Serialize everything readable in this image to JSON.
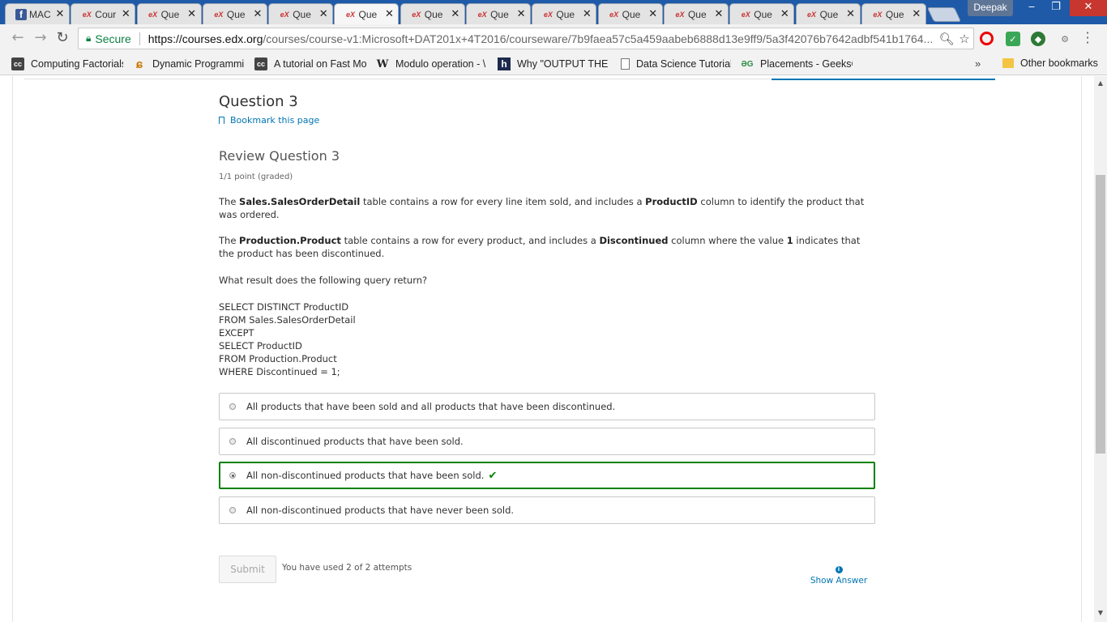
{
  "browser": {
    "tabs": [
      {
        "icon": "facebook-icon",
        "title": "MAC",
        "active": false
      },
      {
        "icon": "edx-icon",
        "title": "Cour",
        "active": false
      },
      {
        "icon": "edx-icon",
        "title": "Que",
        "active": false
      },
      {
        "icon": "edx-icon",
        "title": "Que",
        "active": false
      },
      {
        "icon": "edx-icon",
        "title": "Que",
        "active": false
      },
      {
        "icon": "edx-icon",
        "title": "Que",
        "active": true
      },
      {
        "icon": "edx-icon",
        "title": "Que",
        "active": false
      },
      {
        "icon": "edx-icon",
        "title": "Que",
        "active": false
      },
      {
        "icon": "edx-icon",
        "title": "Que",
        "active": false
      },
      {
        "icon": "edx-icon",
        "title": "Que",
        "active": false
      },
      {
        "icon": "edx-icon",
        "title": "Que",
        "active": false
      },
      {
        "icon": "edx-icon",
        "title": "Que",
        "active": false
      },
      {
        "icon": "edx-icon",
        "title": "Que",
        "active": false
      },
      {
        "icon": "edx-icon",
        "title": "Que",
        "active": false
      }
    ],
    "profile_name": "Deepak",
    "secure_label": "Secure",
    "url_scheme_host": "https://courses.edx.org",
    "url_path": "/courses/course-v1:Microsoft+DAT201x+4T2016/courseware/7b9faea57c5a459aabeb6888d13e9ff9/5a3f42076b7642adbf541b1764..."
  },
  "bookmarks": [
    {
      "icon": "cc-icon",
      "label": "Computing Factorials"
    },
    {
      "icon": "dp-icon",
      "label": "Dynamic Programmin"
    },
    {
      "icon": "cc-icon",
      "label": "A tutorial on Fast Mo"
    },
    {
      "icon": "wikipedia-icon",
      "label": "Modulo operation - \\"
    },
    {
      "icon": "h-icon",
      "label": "Why \"OUTPUT THE A"
    },
    {
      "icon": "page-icon",
      "label": "Data Science Tutorial"
    },
    {
      "icon": "geeks-icon",
      "label": "Placements - GeeksC"
    }
  ],
  "bookmarks_more": "»",
  "other_bookmarks": "Other bookmarks",
  "question": {
    "title": "Question 3",
    "bookmark_label": "Bookmark this page",
    "review_title": "Review Question 3",
    "points": "1/1 point (graded)",
    "p1": {
      "t1": "The ",
      "b1": "Sales.SalesOrderDetail",
      "t2": " table contains a row for every line item sold, and includes a ",
      "b2": "ProductID",
      "t3": " column to identify the product that was ordered."
    },
    "p2": {
      "t1": "The ",
      "b1": "Production.Product",
      "t2": " table contains a row for every product, and includes a ",
      "b2": "Discontinued",
      "t3": " column where the value ",
      "b3": "1",
      "t4": " indicates that the product has been discontinued."
    },
    "prompt": "What result does the following query return?",
    "query_lines": [
      "SELECT DISTINCT ProductID",
      "FROM Sales.SalesOrderDetail",
      "EXCEPT",
      "SELECT ProductID",
      "FROM Production.Product",
      "WHERE Discontinued = 1;"
    ],
    "choices": [
      "All products that have been sold and all products that have been discontinued.",
      "All discontinued products that have been sold.",
      "All non-discontinued products that have been sold.",
      "All non-discontinued products that have never been sold."
    ],
    "selected_choice": 2,
    "correct_color": "#008100",
    "submit_label": "Submit",
    "attempts_text": "You have used 2 of 2 attempts",
    "show_answer_label": "Show Answer"
  },
  "colors": {
    "link": "#0075b4",
    "chrome_frame": "#1e5aa8"
  }
}
